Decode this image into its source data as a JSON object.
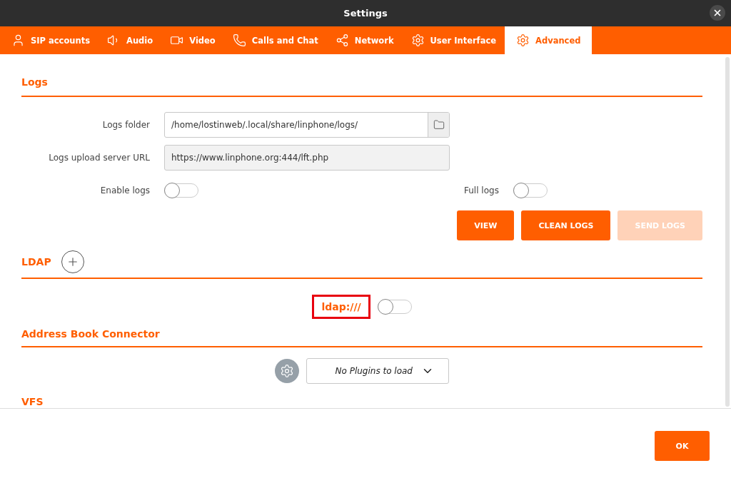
{
  "window": {
    "title": "Settings"
  },
  "tabs": [
    {
      "label": "SIP accounts",
      "selected": false
    },
    {
      "label": "Audio",
      "selected": false
    },
    {
      "label": "Video",
      "selected": false
    },
    {
      "label": "Calls and Chat",
      "selected": false
    },
    {
      "label": "Network",
      "selected": false
    },
    {
      "label": "User Interface",
      "selected": false
    },
    {
      "label": "Advanced",
      "selected": true
    }
  ],
  "logs": {
    "title": "Logs",
    "folder": {
      "label": "Logs folder",
      "value": "/home/lostinweb/.local/share/linphone/logs/"
    },
    "upload_url": {
      "label": "Logs upload server URL",
      "value": "https://www.linphone.org:444/lft.php"
    },
    "enable_logs": {
      "label": "Enable logs",
      "on": false
    },
    "full_logs": {
      "label": "Full logs",
      "on": false
    },
    "buttons": [
      {
        "label": "VIEW",
        "disabled": false
      },
      {
        "label": "CLEAN LOGS",
        "disabled": false
      },
      {
        "label": "SEND LOGS",
        "disabled": true
      }
    ]
  },
  "ldap": {
    "title": "LDAP",
    "servers": [
      {
        "label": "ldap:///",
        "on": false,
        "highlighted": true
      }
    ]
  },
  "address_book": {
    "title": "Address Book Connector",
    "plugin_select": {
      "value": "No Plugins to load"
    }
  },
  "vfs": {
    "title": "VFS"
  },
  "footer": {
    "ok_button": "OK"
  }
}
